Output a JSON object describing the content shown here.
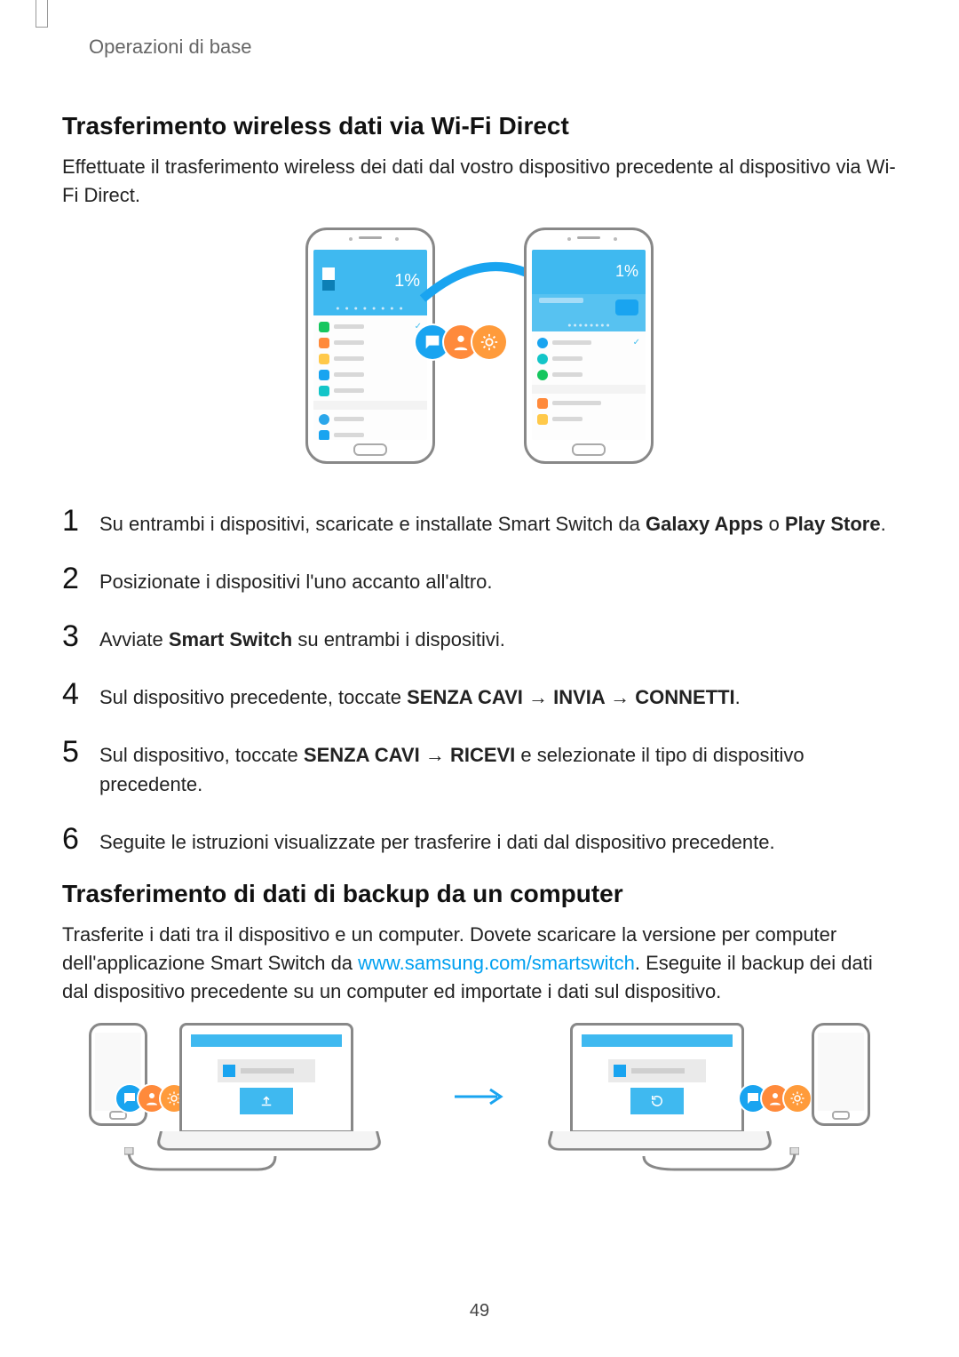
{
  "breadcrumb": "Operazioni di base",
  "page_number": "49",
  "section1": {
    "title": "Trasferimento wireless dati via Wi-Fi Direct",
    "intro": "Effettuate il trasferimento wireless dei dati dal vostro dispositivo precedente al dispositivo via Wi-Fi Direct.",
    "illus_percent": "1%",
    "steps": {
      "s1": {
        "num": "1",
        "pre": "Su entrambi i dispositivi, scaricate e installate Smart Switch da ",
        "b1": "Galaxy Apps",
        "mid": " o ",
        "b2": "Play Store",
        "post": "."
      },
      "s2": {
        "num": "2",
        "text": "Posizionate i dispositivi l'uno accanto all'altro."
      },
      "s3": {
        "num": "3",
        "pre": "Avviate ",
        "b1": "Smart Switch",
        "post": " su entrambi i dispositivi."
      },
      "s4": {
        "num": "4",
        "pre": "Sul dispositivo precedente, toccate ",
        "b1": "SENZA CAVI",
        "a1": " → ",
        "b2": "INVIA",
        "a2": " → ",
        "b3": "CONNETTI",
        "post": "."
      },
      "s5": {
        "num": "5",
        "pre": "Sul dispositivo, toccate ",
        "b1": "SENZA CAVI",
        "a1": " → ",
        "b2": "RICEVI",
        "post": " e selezionate il tipo di dispositivo precedente."
      },
      "s6": {
        "num": "6",
        "text": "Seguite le istruzioni visualizzate per trasferire i dati dal dispositivo precedente."
      }
    }
  },
  "section2": {
    "title": "Trasferimento di dati di backup da un computer",
    "intro_pre": "Trasferite i dati tra il dispositivo e un computer. Dovete scaricare la versione per computer dell'applicazione Smart Switch da ",
    "link_text": "www.samsung.com/smartswitch",
    "intro_post": ". Eseguite il backup dei dati dal dispositivo precedente su un computer ed importate i dati sul dispositivo."
  }
}
